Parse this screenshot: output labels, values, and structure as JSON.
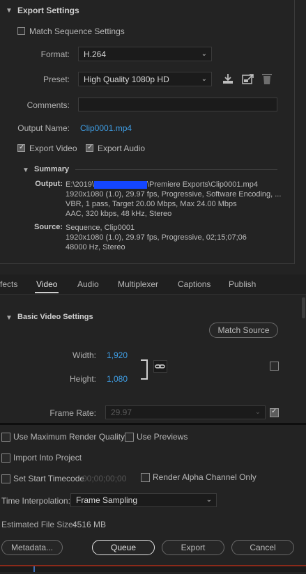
{
  "export_settings": {
    "title": "Export Settings",
    "match_sequence_label": "Match Sequence Settings",
    "match_sequence_checked": false,
    "format_label": "Format:",
    "format_value": "H.264",
    "preset_label": "Preset:",
    "preset_value": "High Quality 1080p HD",
    "preset_icons": [
      "save-preset-icon",
      "import-preset-icon",
      "delete-preset-icon"
    ],
    "comments_label": "Comments:",
    "comments_value": "",
    "output_name_label": "Output Name:",
    "output_name_value": "Clip0001.mp4",
    "export_video_label": "Export Video",
    "export_video_checked": true,
    "export_audio_label": "Export Audio",
    "export_audio_checked": true
  },
  "summary": {
    "title": "Summary",
    "output_key": "Output:",
    "output_path_prefix": "E:\\2019\\",
    "output_path_suffix": "\\Premiere Exports\\Clip0001.mp4",
    "output_lines": [
      "1920x1080 (1.0), 29.97 fps, Progressive, Software Encoding, ...",
      "VBR, 1 pass, Target 20.00 Mbps, Max 24.00 Mbps",
      "AAC, 320 kbps, 48 kHz, Stereo"
    ],
    "source_key": "Source:",
    "source_lines": [
      "Sequence, Clip0001",
      "1920x1080 (1.0), 29.97 fps, Progressive, 02;15;07;06",
      "48000 Hz, Stereo"
    ]
  },
  "tabs": [
    {
      "label": "fects",
      "active": false
    },
    {
      "label": "Video",
      "active": true
    },
    {
      "label": "Audio",
      "active": false
    },
    {
      "label": "Multiplexer",
      "active": false
    },
    {
      "label": "Captions",
      "active": false
    },
    {
      "label": "Publish",
      "active": false
    }
  ],
  "video": {
    "section_title": "Basic Video Settings",
    "match_source_label": "Match Source",
    "width_label": "Width:",
    "width_value": "1,920",
    "height_label": "Height:",
    "height_value": "1,080",
    "link_icon": "chain-link-icon",
    "frame_rate_label": "Frame Rate:",
    "frame_rate_value": "29.97",
    "frame_rate_checked": true
  },
  "bottom": {
    "max_render_label": "Use Maximum Render Quality",
    "use_previews_label": "Use Previews",
    "import_project_label": "Import Into Project",
    "set_start_tc_label": "Set Start Timecode",
    "start_tc_value": "00;00;00;00",
    "render_alpha_label": "Render Alpha Channel Only",
    "time_interp_label": "Time Interpolation:",
    "time_interp_value": "Frame Sampling",
    "file_size_label": "Estimated File Size:",
    "file_size_value": "4516 MB",
    "buttons": {
      "metadata": "Metadata...",
      "queue": "Queue",
      "export": "Export",
      "cancel": "Cancel"
    }
  },
  "colors": {
    "accent_link": "#3f9fe6",
    "redaction": "#1446ff",
    "bottom_strip": "#8b2a1a"
  }
}
